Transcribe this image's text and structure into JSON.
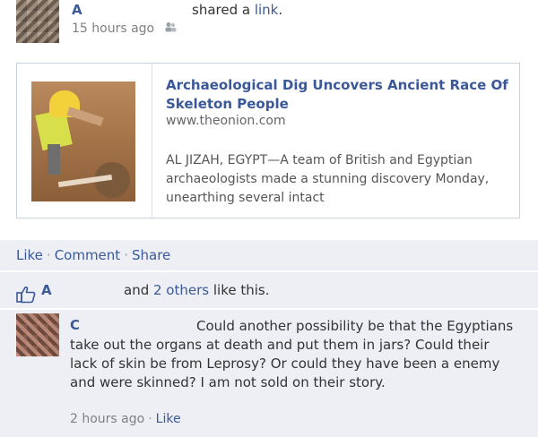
{
  "story": {
    "author": "A",
    "action_text": "shared a ",
    "action_link": "link",
    "action_end": ".",
    "timestamp": "15 hours ago"
  },
  "attachment": {
    "title": "Archaeological Dig Uncovers Ancient Race Of Skeleton People",
    "url": "www.theonion.com",
    "description": "AL JIZAH, EGYPT—A team of British and Egyptian archaeologists made a stunning discovery Monday, unearthing several intact"
  },
  "actions": {
    "like": "Like",
    "comment": "Comment",
    "share": "Share",
    "separator": "·"
  },
  "likes": {
    "liker": "A",
    "and_text": "and ",
    "others_link": "2 others",
    "like_this": " like this."
  },
  "comment": {
    "author": "C",
    "text": "Could another possibility be that the Egyptians take out the organs at death and put them in jars? Could their lack of skin be from Leprosy? Or could they have been a enemy and were skinned? I am not sold on their story.",
    "timestamp": "2 hours ago",
    "like": "Like",
    "separator": "·"
  },
  "colors": {
    "link": "#3b5998",
    "panel_bg": "#edeff4",
    "border": "#c9d2e2"
  }
}
